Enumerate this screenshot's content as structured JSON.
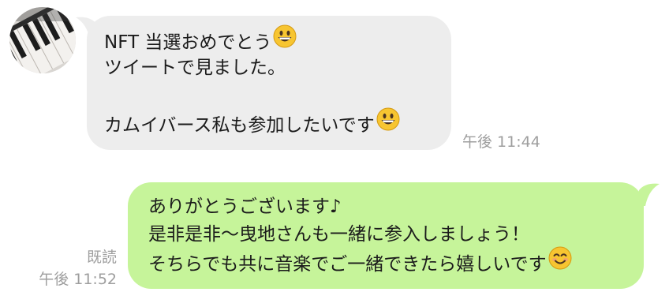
{
  "incoming": {
    "lines": [
      "NFT 当選おめでとう",
      "ツイートで見ました。",
      "",
      "カムイバース私も参加したいです"
    ],
    "emoji": [
      "grinning-face",
      "grinning-face"
    ],
    "time": "午後 11:44"
  },
  "outgoing": {
    "lines": [
      "ありがとうございます♪",
      "是非是非〜曳地さんも一緒に参入しましょう！",
      "そちらでも共に音楽でご一緒できたら嬉しいです"
    ],
    "emoji": [
      "smiling-face-with-smiling-eyes"
    ],
    "read_status": "既読",
    "time": "午後 11:52"
  },
  "colors": {
    "incoming_bubble": "#ededed",
    "outgoing_bubble": "#c6f49a",
    "meta_text": "#9e9e9e",
    "emoji_yellow": "#f7c531"
  }
}
